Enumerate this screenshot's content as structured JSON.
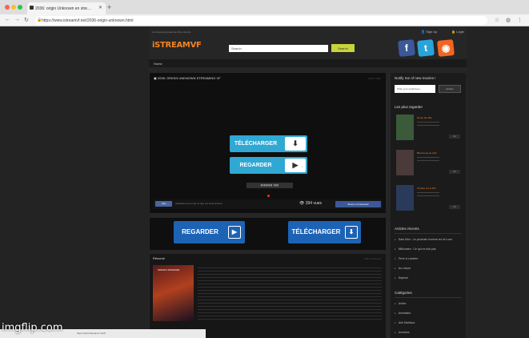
{
  "browser": {
    "tab_title": "2036: origin Unknown en stre…",
    "url": "https://www.istreamvf.net/2036-origin-unknown.html",
    "new_tab_label": "+",
    "colors": {
      "close": "#ff5f57",
      "minimize": "#febc2e",
      "maximize": "#28c840"
    }
  },
  "header": {
    "top_notice": "Le streaming gratuit de films récents",
    "logo_text": "iSTREAMVF",
    "search_placeholder": "Search",
    "search_button": "Search",
    "sign_up": "Sign Up",
    "login": "Login",
    "social": [
      {
        "icon": "facebook-icon",
        "glyph": "f",
        "color": "#3b5998"
      },
      {
        "icon": "twitter-icon",
        "glyph": "t",
        "color": "#2aa3d8"
      },
      {
        "icon": "rss-icon",
        "glyph": "◉",
        "color": "#f26522"
      }
    ]
  },
  "nav": {
    "home": "Home"
  },
  "main": {
    "title": "2036: ORIGIN UNKNOWN STREAMING VF",
    "right_text": "Sci-Fi / Film",
    "telecharger_label": "TÉLÉCHARGER",
    "regarder_label": "REGARDER",
    "seek_text": "▮▮▮▮▮▮▮ ▮▮▮",
    "like_label": "Like",
    "like_text": "Inscription pour voir ce que vos amis aiment.",
    "views": "394 vues",
    "share_label": "Share on Facebook"
  },
  "actions": {
    "regarder_label": "REGARDER",
    "telecharger_label": "TÉLÉCHARGER"
  },
  "resume": {
    "title": "Résumé",
    "right_text": "Add a comment",
    "poster_title": "ORIGIN UNKNOWN"
  },
  "sidebar": {
    "notify_title": "Notify me of new movies !",
    "email_placeholder": "Write your email here...",
    "email_button": "Activer",
    "popular_title": "Les plus regarder",
    "movies": [
      {
        "title": "Nome de Ville",
        "button": "Voir",
        "thumb": "#3a5a3a"
      },
      {
        "title": "Bienvenue au club",
        "button": "Voir",
        "thumb": "#4a3a3a"
      },
      {
        "title": "Tomber sur le film",
        "button": "Voir",
        "thumb": "#2a3a5a"
      }
    ],
    "recent_title": "Articles récents",
    "recent": [
      "Dark Mon : Le prochain homme sur la Lune",
      "Millionaire : Ce qui ne doit pas",
      "Terre à Lumière",
      "Au chaud",
      "Daphne"
    ],
    "categories_title": "Catégories",
    "categories": [
      "Action",
      "Animation",
      "Arts Martiaux",
      "Aventure"
    ]
  },
  "statusbar": {
    "text": "https://www.istreamvf.net/#"
  },
  "watermark": "imgflip.com"
}
